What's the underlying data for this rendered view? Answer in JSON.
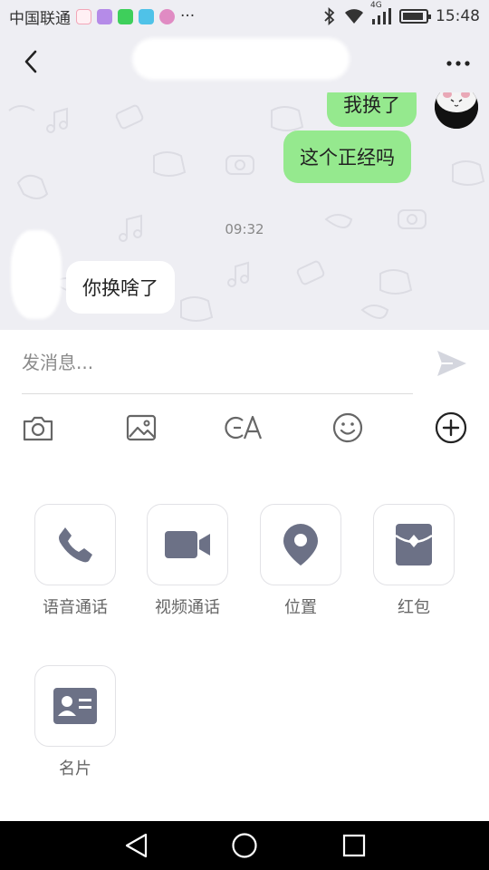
{
  "status_bar": {
    "carrier": "中国联通",
    "overflow": "···",
    "network": "4G",
    "time": "15:48",
    "battery_level": 0.9
  },
  "header": {
    "back_icon": "chevron-left-icon",
    "more_icon": "more-horizontal-icon"
  },
  "chat": {
    "messages": [
      {
        "direction": "outgoing",
        "text": "我换了"
      },
      {
        "direction": "outgoing",
        "text": "这个正经吗"
      },
      {
        "direction": "incoming",
        "text": "你换啥了"
      }
    ],
    "timestamp": "09:32",
    "colors": {
      "outgoing": "#95e98e",
      "incoming": "#ffffff",
      "background": "#eeeef3"
    }
  },
  "composer": {
    "placeholder": "发消息...",
    "value": "",
    "send_icon": "send-icon"
  },
  "toolbar": {
    "items": [
      {
        "icon": "camera-icon"
      },
      {
        "icon": "image-icon"
      },
      {
        "icon": "translate-icon"
      },
      {
        "icon": "emoji-icon"
      },
      {
        "icon": "plus-circle-icon"
      }
    ]
  },
  "actions": [
    {
      "icon": "phone-icon",
      "label": "语音通话"
    },
    {
      "icon": "video-camera-icon",
      "label": "视频通话"
    },
    {
      "icon": "location-icon",
      "label": "位置"
    },
    {
      "icon": "red-envelope-icon",
      "label": "红包"
    },
    {
      "icon": "contact-card-icon",
      "label": "名片"
    }
  ],
  "navbar": {
    "items": [
      {
        "icon": "back-triangle-icon"
      },
      {
        "icon": "home-circle-icon"
      },
      {
        "icon": "recents-square-icon"
      }
    ]
  }
}
